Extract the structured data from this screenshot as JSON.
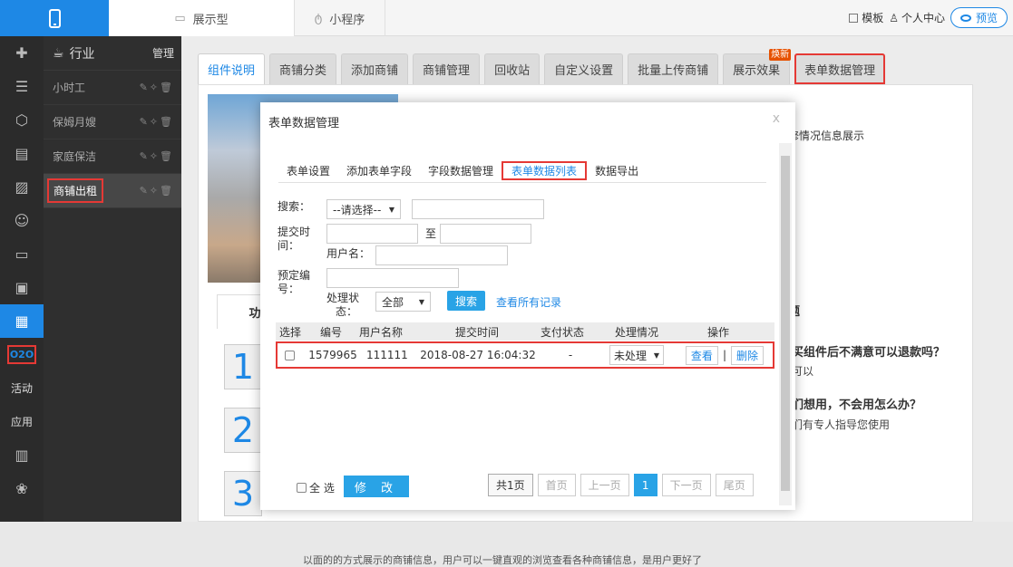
{
  "topbar": {
    "tabs": [
      {
        "label": "展示型"
      },
      {
        "label": "小程序"
      }
    ],
    "template_label": "模板",
    "user_center_label": "个人中心",
    "preview_label": "预览"
  },
  "iconbar": {
    "o2o_label": "O2O",
    "activity_label": "活动",
    "app_label": "应用"
  },
  "catpanel": {
    "title": "行业",
    "manage_label": "管理",
    "items": [
      {
        "label": "小时工"
      },
      {
        "label": "保姆月嫂"
      },
      {
        "label": "家庭保洁"
      },
      {
        "label": "商铺出租"
      }
    ]
  },
  "main": {
    "tabs": [
      {
        "label": "组件说明"
      },
      {
        "label": "商铺分类"
      },
      {
        "label": "添加商铺"
      },
      {
        "label": "商铺管理"
      },
      {
        "label": "回收站"
      },
      {
        "label": "自定义设置"
      },
      {
        "label": "批量上传商铺"
      },
      {
        "label": "展示效果"
      },
      {
        "label": "表单数据管理"
      }
    ],
    "new_badge": "焕新",
    "bg_text_right": "修情况信息展示",
    "bg_tab_left": "功能描",
    "bg_tab_right": "题",
    "faq": [
      {
        "num": "1",
        "q": "买组件后不满意可以退款吗？",
        "a": "可以"
      },
      {
        "num": "2",
        "q": "们想用，不会用怎么办？",
        "a": "们有专人指导您使用"
      },
      {
        "num": "3"
      }
    ],
    "bg_bottom_text": "以面的的方式展示的商铺信息，用户可以一键直观的浏览查看各种商铺信息，是用户更好了"
  },
  "modal": {
    "title": "表单数据管理",
    "close": "x",
    "tabs": [
      {
        "label": "表单设置"
      },
      {
        "label": "添加表单字段"
      },
      {
        "label": "字段数据管理"
      },
      {
        "label": "表单数据列表"
      },
      {
        "label": "数据导出"
      }
    ],
    "filters": {
      "search_label": "搜索：",
      "search_select": "--请选择--",
      "submit_time_label_1": "提交时",
      "submit_time_label_2": "间：",
      "to_label": "至",
      "username_label": "用户名：",
      "reserve_label_1": "预定编",
      "reserve_label_2": "号：",
      "status_label_1": "处理状",
      "status_label_2": "态：",
      "status_select": "全部",
      "search_button": "搜索",
      "view_all": "查看所有记录"
    },
    "table": {
      "headers": [
        "选择",
        "编号",
        "用户名称",
        "提交时间",
        "支付状态",
        "处理情况",
        "操作"
      ],
      "rows": [
        {
          "id": "1579965",
          "username": "111111",
          "time": "2018-08-27 16:04:32",
          "pay": "-",
          "status": "未处理",
          "view": "查看",
          "sep": "|",
          "delete": "删除"
        }
      ]
    },
    "select_all": "全 选",
    "modify_button": "修 改",
    "pager": {
      "total": "共1页",
      "first": "首页",
      "prev": "上一页",
      "current": "1",
      "next": "下一页",
      "last": "尾页"
    }
  }
}
